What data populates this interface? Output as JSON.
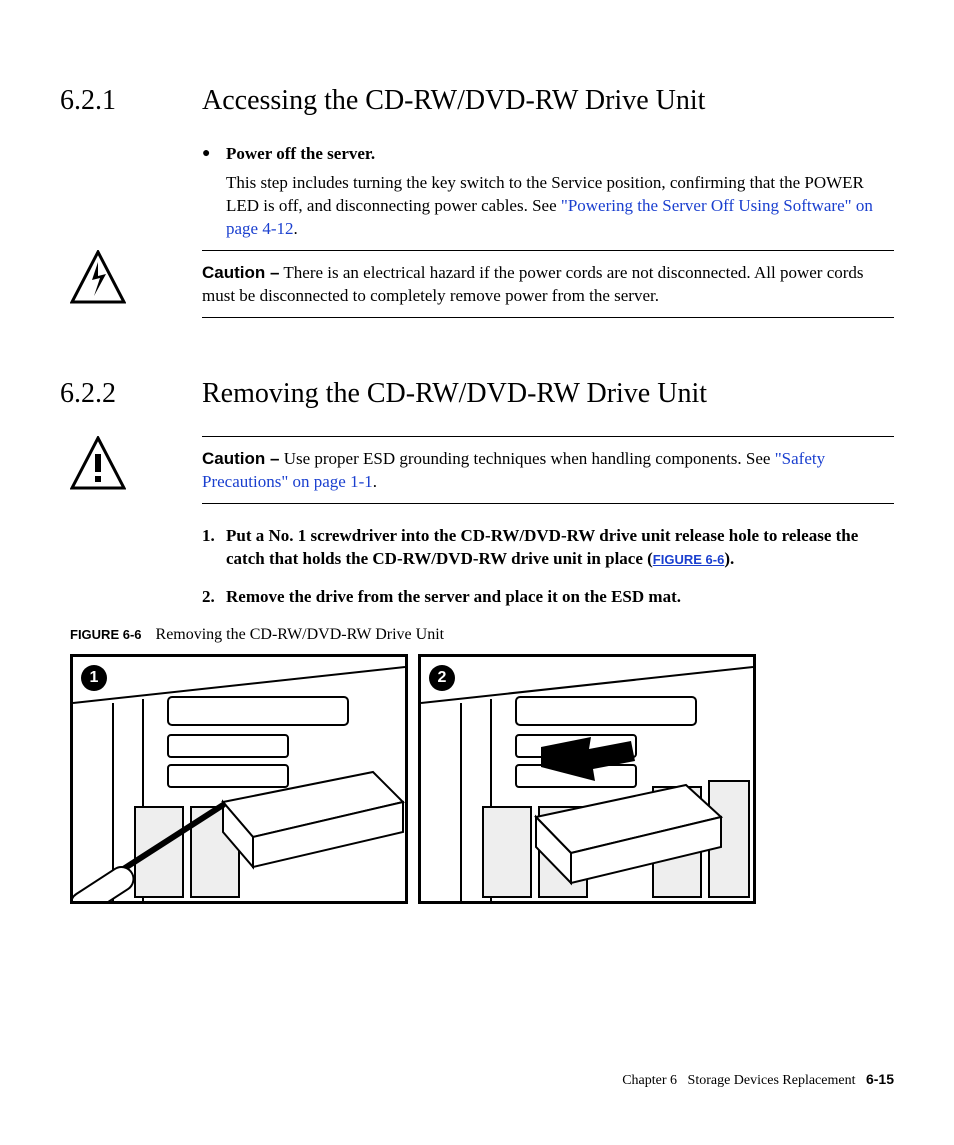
{
  "section1": {
    "number": "6.2.1",
    "title": "Accessing the CD-RW/DVD-RW Drive Unit",
    "bullet_label": "Power off the server.",
    "bullet_body_pre": "This step includes turning the key switch to the Service position, confirming that the POWER LED is off, and disconnecting power cables. See ",
    "bullet_link": "\"Powering the Server Off Using Software\" on page 4-12",
    "bullet_body_post": "."
  },
  "caution1": {
    "label": "Caution –",
    "text": " There is an electrical hazard if the power cords are not disconnected. All power cords must be disconnected to completely remove power from the server."
  },
  "section2": {
    "number": "6.2.2",
    "title": "Removing the CD-RW/DVD-RW Drive Unit"
  },
  "caution2": {
    "label": "Caution –",
    "text_pre": " Use proper ESD grounding techniques when handling components. See ",
    "link": "\"Safety Precautions\" on page 1-1",
    "text_post": "."
  },
  "steps": {
    "s1_num": "1.",
    "s1_text_pre": "Put a No. 1 screwdriver into the CD-RW/DVD-RW drive unit release hole to release the catch that holds the CD-RW/DVD-RW drive unit in place (",
    "s1_ref": "FIGURE 6-6",
    "s1_text_post": ").",
    "s2_num": "2.",
    "s2_text": "Remove the drive from the server and place it on the ESD mat."
  },
  "figure": {
    "label": "FIGURE 6-6",
    "caption": "Removing the CD-RW/DVD-RW Drive Unit",
    "badge1": "1",
    "badge2": "2"
  },
  "footer": {
    "chapter": "Chapter 6",
    "title": "Storage Devices Replacement",
    "page": "6-15"
  }
}
